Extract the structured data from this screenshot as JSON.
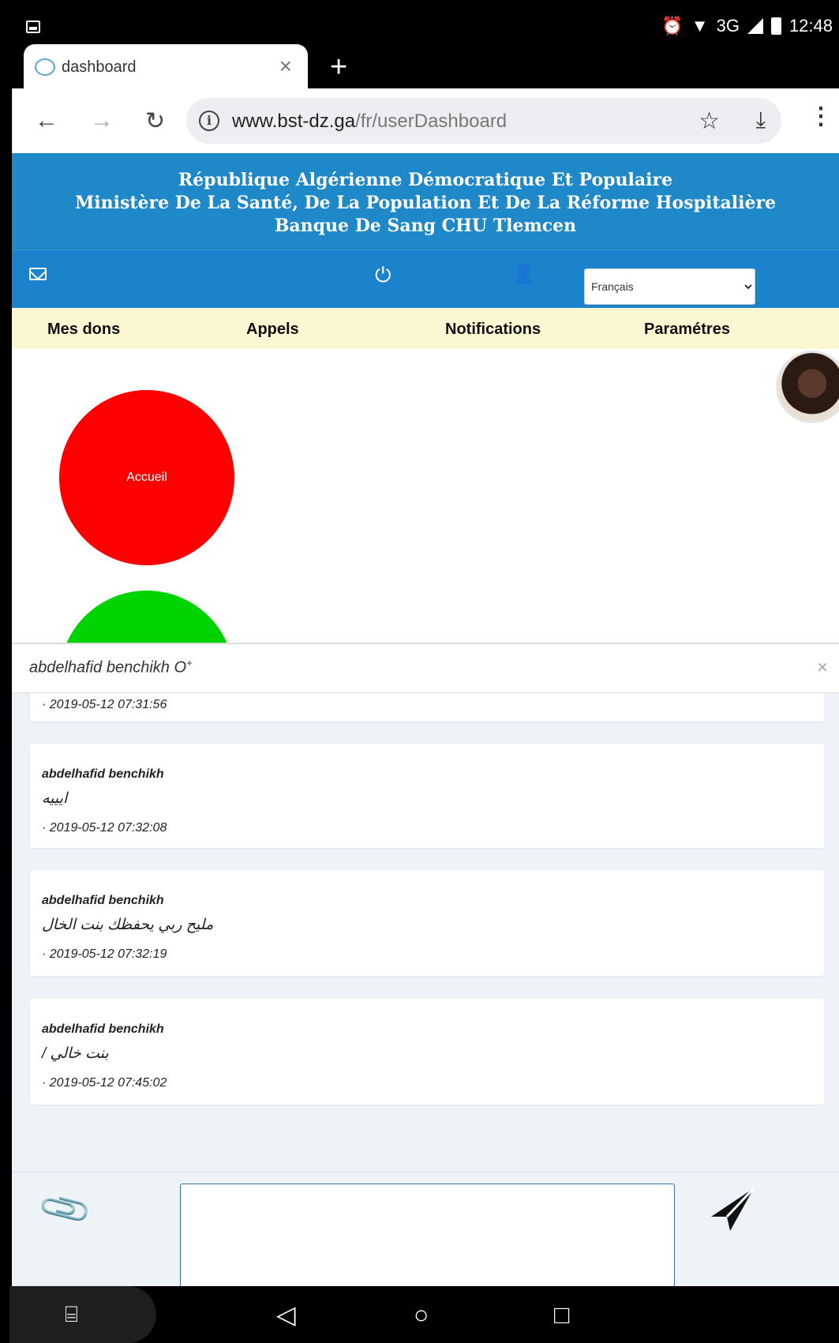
{
  "status_bar": {
    "time": "12:48",
    "network": "3G",
    "icons": [
      "image-icon",
      "alarm-icon",
      "wifi-icon",
      "signal-icon",
      "battery-icon"
    ]
  },
  "browser": {
    "tab_title": "dashboard",
    "url_host": "www.bst-dz.ga",
    "url_path": "/fr/userDashboard"
  },
  "banner": {
    "line1": "République Algérienne Démocratique Et Populaire",
    "line2": "Ministère De La Santé, De La Population Et De La Réforme Hospitalière",
    "line3": "Banque De Sang CHU Tlemcen",
    "color": "#1e88c9"
  },
  "iconbar": {
    "language_selected": "Français"
  },
  "menu": {
    "items": [
      {
        "label": "Mes dons"
      },
      {
        "label": "Appels"
      },
      {
        "label": "Notifications"
      },
      {
        "label": "Paramétres"
      }
    ]
  },
  "circles": {
    "red_label": "Accueil",
    "red_color": "#ff0000",
    "green_color": "#00d400"
  },
  "chat": {
    "title": "abdelhafid benchikh O",
    "title_sup": "+",
    "partial_time": "· 2019-05-12 07:31:56",
    "messages": [
      {
        "author": "abdelhafid benchikh",
        "text": "ايييه",
        "time": "· 2019-05-12 07:32:08"
      },
      {
        "author": "abdelhafid benchikh",
        "text": "مليح ربي يحفظك بنت الخال",
        "time": "· 2019-05-12 07:32:19"
      },
      {
        "author": "abdelhafid benchikh",
        "text": "بنت خالي /",
        "time": "· 2019-05-12 07:45:02"
      }
    ],
    "composer_value": ""
  }
}
